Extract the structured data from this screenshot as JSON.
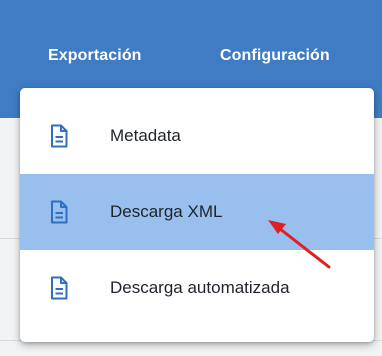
{
  "header": {
    "tabs": [
      {
        "label": "Exportación"
      },
      {
        "label": "Configuración"
      }
    ],
    "background_color": "#3f7cc4"
  },
  "dropdown_menu": {
    "items": [
      {
        "label": "Metadata",
        "icon": "document-icon",
        "selected": false
      },
      {
        "label": "Descarga XML",
        "icon": "document-icon",
        "selected": true
      },
      {
        "label": "Descarga automatizada",
        "icon": "document-icon",
        "selected": false
      }
    ],
    "selected_color": "#98bfee",
    "icon_color": "#2f6fc2"
  },
  "annotation": {
    "arrow_color": "#e02020",
    "points_to": "Descarga XML"
  }
}
